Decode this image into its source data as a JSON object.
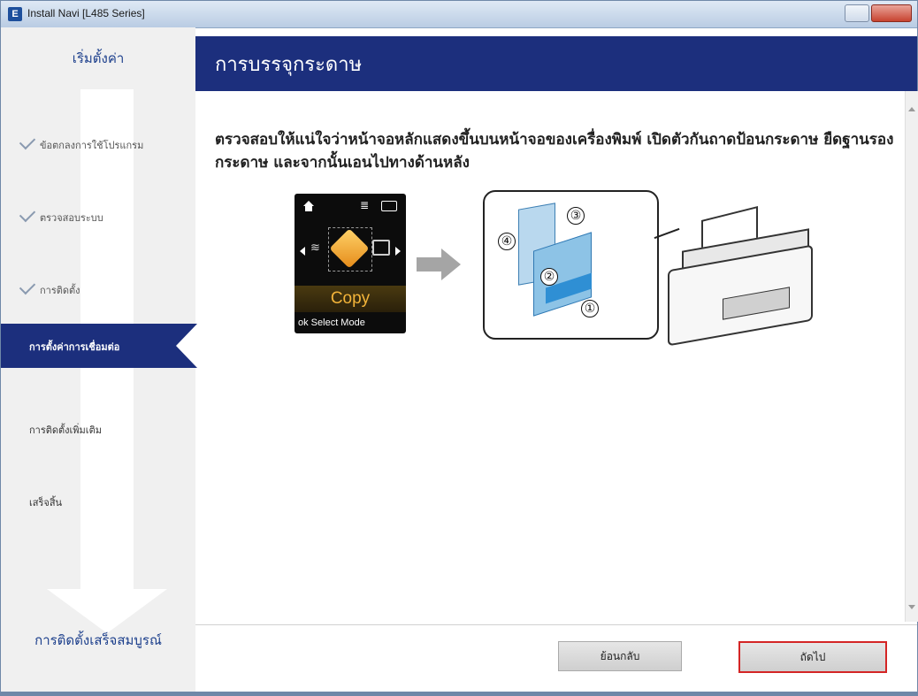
{
  "window": {
    "title": "Install Navi [L485 Series]"
  },
  "sidebar": {
    "header": "เริ่มตั้งค่า",
    "steps": [
      {
        "label": "ข้อตกลงการใช้โปรแกรม",
        "state": "done"
      },
      {
        "label": "ตรวจสอบระบบ",
        "state": "done"
      },
      {
        "label": "การติดตั้ง",
        "state": "done"
      },
      {
        "label": "การตั้งค่าการเชื่อมต่อ",
        "state": "active"
      },
      {
        "label": "การติดตั้งเพิ่มเติม",
        "state": "pending"
      },
      {
        "label": "เสร็จสิ้น",
        "state": "pending"
      }
    ],
    "footer": "การติดตั้งเสร็จสมบูรณ์"
  },
  "header": {
    "title": "การบรรจุกระดาษ"
  },
  "main": {
    "instruction": "ตรวจสอบให้แน่ใจว่าหน้าจอหลักแสดงขึ้นบนหน้าจอของเครื่องพิมพ์ เปิดตัวกันถาดป้อนกระดาษ ยืดฐานรองกระดาษ และจากนั้นเอนไปทางด้านหลัง",
    "lcd": {
      "copy_label": "Copy",
      "mode_label": "ok Select Mode"
    },
    "steps_numbers": [
      "①",
      "②",
      "③",
      "④"
    ]
  },
  "footer": {
    "back_label": "ย้อนกลับ",
    "next_label": "ถัดไป"
  },
  "colors": {
    "accent": "#1c2f7d",
    "highlight": "#d42525"
  }
}
